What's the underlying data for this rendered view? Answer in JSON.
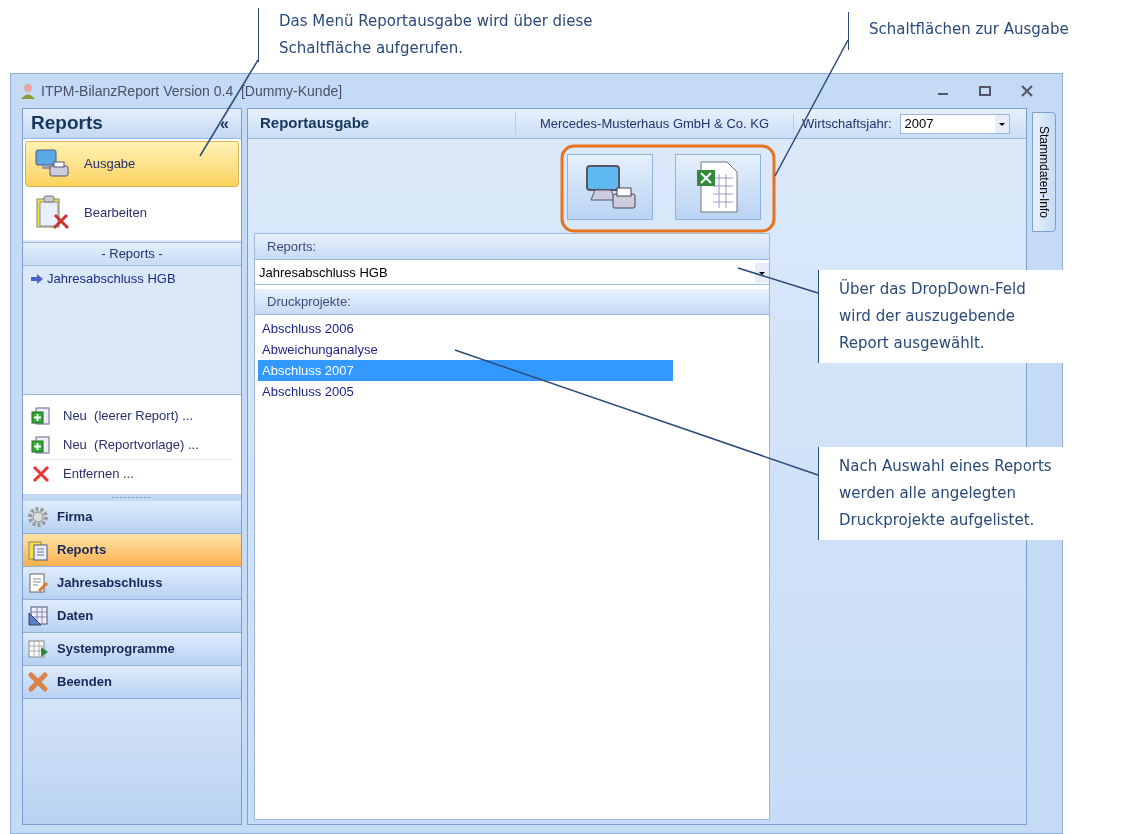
{
  "window": {
    "title": "ITPM-BilanzReport Version 0.4  [Dummy-Kunde]"
  },
  "sidebar": {
    "title": "Reports",
    "collapse": "«",
    "items": [
      {
        "label": "Ausgabe",
        "kind": "output",
        "selected": true
      },
      {
        "label": "Bearbeiten",
        "kind": "edit",
        "selected": false
      }
    ],
    "section_header": "- Reports -",
    "tree": [
      {
        "label": "Jahresabschluss HGB"
      }
    ],
    "actions": [
      {
        "label": "Neu  (leerer Report) ...",
        "kind": "new"
      },
      {
        "label": "Neu  (Reportvorlage) ...",
        "kind": "new"
      },
      {
        "label": "Entfernen ...",
        "kind": "remove"
      }
    ],
    "nav": [
      {
        "label": "Firma",
        "kind": "gear",
        "selected": false
      },
      {
        "label": "Reports",
        "kind": "reports",
        "selected": true
      },
      {
        "label": "Jahresabschluss",
        "kind": "annual",
        "selected": false
      },
      {
        "label": "Daten",
        "kind": "data",
        "selected": false
      },
      {
        "label": "Systemprogramme",
        "kind": "system",
        "selected": false
      },
      {
        "label": "Beenden",
        "kind": "exit",
        "selected": false
      }
    ]
  },
  "main": {
    "title": "Reportausgabe",
    "company": "Mercedes-Musterhaus GmbH & Co. KG",
    "year_label": "Wirtschaftsjahr:",
    "year": "2007",
    "reports_label": "Reports:",
    "report": "Jahresabschluss HGB",
    "projects_label": "Druckprojekte:",
    "projects": [
      {
        "label": "Abschluss 2006",
        "selected": false
      },
      {
        "label": "Abweichunganalyse",
        "selected": false
      },
      {
        "label": "Abschluss 2007",
        "selected": true
      },
      {
        "label": "Abschluss 2005",
        "selected": false
      }
    ]
  },
  "side_tab": "Stammdaten-Info",
  "annotations": [
    {
      "text": "Das Menü Reportausgabe wird über diese Schaltfläche aufgerufen."
    },
    {
      "text": "Schaltflächen zur Ausgabe"
    },
    {
      "text": "Über das DropDown-Feld wird der auszugebende Report ausgewählt."
    },
    {
      "text": "Nach Auswahl eines Reports werden alle angelegten Druckprojekte aufgelistet."
    }
  ]
}
